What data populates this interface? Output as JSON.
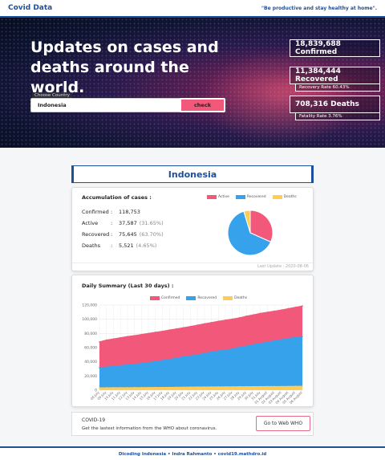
{
  "header": {
    "brand": "Covid Data",
    "tagline": "\"Be productive and stay healthy at home\"."
  },
  "hero": {
    "title": "Updates on cases and deaths around the world.",
    "choose_label": "Choose Country",
    "country_value": "Indonesia",
    "check_label": "check"
  },
  "global": {
    "confirmed": "18,839,688 Confirmed",
    "recovered": "11,384,444 Recovered",
    "recovery_rate": "Recovery Rate 60.43%",
    "deaths": "708,316 Deaths",
    "fatality_rate": "Fatality Rate 3.76%"
  },
  "country": {
    "name": "Indonesia"
  },
  "accumulation": {
    "title": "Accumulation of cases :",
    "rows": [
      {
        "label": "Confirmed",
        "sep": ":",
        "value": "118,753",
        "pct": ""
      },
      {
        "label": "Active",
        "sep": ":",
        "value": "37,587",
        "pct": "(31.65%)"
      },
      {
        "label": "Recovered",
        "sep": ":",
        "value": "75,645",
        "pct": "(63.70%)"
      },
      {
        "label": "Deaths",
        "sep": ":",
        "value": "5,521",
        "pct": "(4.65%)"
      }
    ],
    "last_update": "Last Update : 2020-08-06"
  },
  "colors": {
    "active": "#f2587a",
    "recovered": "#36a2eb",
    "deaths": "#ffcd56",
    "accent": "#1e4f9a"
  },
  "pie_legend": [
    "Active",
    "Recovered",
    "Deaths"
  ],
  "chart_data": [
    {
      "type": "pie",
      "categories": [
        "Active",
        "Recovered",
        "Deaths"
      ],
      "values": [
        37587,
        75645,
        5521
      ]
    },
    {
      "type": "area",
      "title": "Daily Summary (Last 30 days) :",
      "series": [
        {
          "name": "Confirmed",
          "values": [
            68079,
            70736,
            72347,
            74018,
            75699,
            76981,
            78572,
            80094,
            81668,
            83130,
            84882,
            86521,
            88214,
            89869,
            91751,
            93657,
            95418,
            97286,
            98778,
            100303,
            102051,
            104432,
            106336,
            108376,
            109936,
            111455,
            113134,
            115056,
            116871,
            118753
          ]
        },
        {
          "name": "Recovered",
          "values": [
            31585,
            32651,
            33529,
            34719,
            35638,
            36689,
            37636,
            39050,
            40345,
            41834,
            43268,
            45401,
            46977,
            48466,
            49788,
            51917,
            53945,
            55354,
            56655,
            58173,
            60539,
            62138,
            64292,
            65907,
            67919,
            69478,
            71099,
            73109,
            74201,
            75645
          ]
        },
        {
          "name": "Deaths",
          "values": [
            3359,
            3417,
            3469,
            3535,
            3606,
            3656,
            3710,
            3797,
            3873,
            3957,
            4016,
            4143,
            4239,
            4320,
            4459,
            4576,
            4665,
            4714,
            4781,
            4838,
            4901,
            4975,
            5058,
            5131,
            5193,
            5236,
            5302,
            5388,
            5452,
            5521
          ]
        }
      ],
      "ylim": [
        0,
        120000
      ],
      "y_ticks": [
        "0",
        "20,000",
        "40,000",
        "60,000",
        "80,000",
        "100,000",
        "120,000"
      ],
      "x": [
        "08 July",
        "09 July",
        "10 July",
        "11 July",
        "12 July",
        "13 July",
        "14 July",
        "15 July",
        "16 July",
        "17 July",
        "18 July",
        "19 July",
        "20 July",
        "21 July",
        "22 July",
        "23 July",
        "24 July",
        "25 July",
        "26 July",
        "27 July",
        "28 July",
        "29 July",
        "30 July",
        "31 July",
        "01 August",
        "02 August",
        "03 August",
        "04 August",
        "05 August",
        "06 August"
      ],
      "legend_position": "top"
    }
  ],
  "who": {
    "title": "COVID-19",
    "desc": "Get the lastest information from the WHO about coronavirus.",
    "button": "Go to Web WHO"
  },
  "footer": {
    "text": "Dicoding Indonesia • Indra Rahmanto • covid19.mathdro.id"
  }
}
